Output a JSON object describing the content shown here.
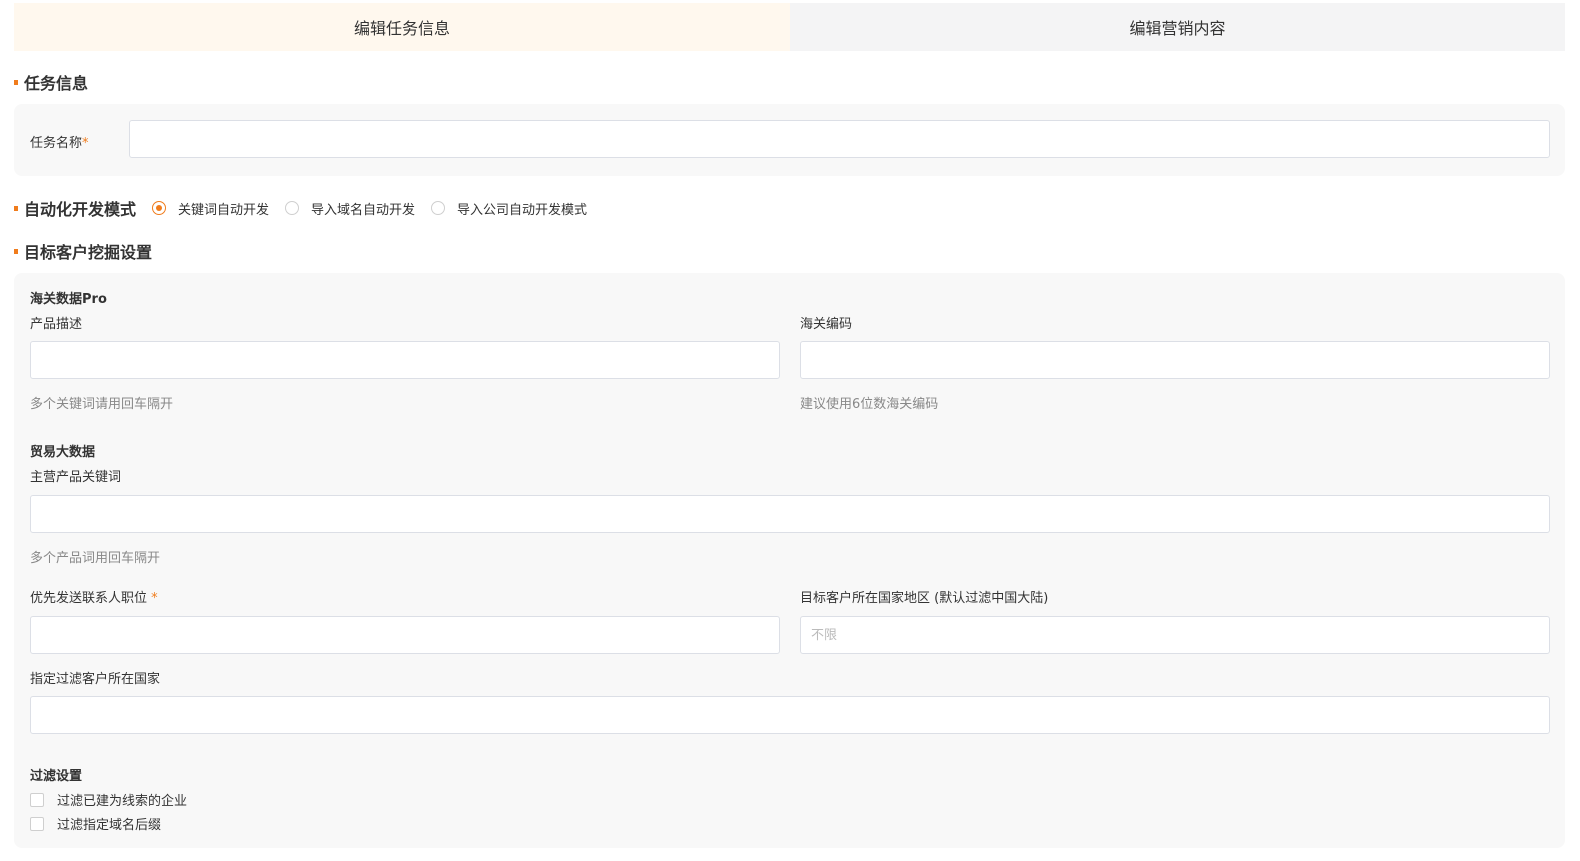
{
  "tabs": [
    {
      "label": "编辑任务信息",
      "active": true
    },
    {
      "label": "编辑营销内容",
      "active": false
    }
  ],
  "task_info": {
    "section_title": "任务信息",
    "name_label": "任务名称",
    "required_mark": "*",
    "name_value": ""
  },
  "mode": {
    "section_title": "自动化开发模式",
    "options": [
      {
        "label": "关键词自动开发",
        "checked": true
      },
      {
        "label": "导入域名自动开发",
        "checked": false
      },
      {
        "label": "导入公司自动开发模式",
        "checked": false
      }
    ]
  },
  "mining": {
    "section_title": "目标客户挖掘设置",
    "customs": {
      "group_title": "海关数据Pro",
      "product_label": "产品描述",
      "product_value": "",
      "product_hint": "多个关键词请用回车隔开",
      "hscode_label": "海关编码",
      "hscode_value": "",
      "hscode_hint": "建议使用6位数海关编码"
    },
    "trade": {
      "group_title": "贸易大数据",
      "keywords_label": "主营产品关键词",
      "keywords_value": "",
      "keywords_hint": "多个产品词用回车隔开"
    },
    "position_label": "优先发送联系人职位",
    "position_required": "*",
    "position_value": "",
    "country_label": "目标客户所在国家地区 (默认过滤中国大陆)",
    "country_placeholder": "不限",
    "filter_country_label": "指定过滤客户所在国家",
    "filter_country_value": "",
    "filter": {
      "group_title": "过滤设置",
      "options": [
        {
          "label": "过滤已建为线索的企业",
          "checked": false
        },
        {
          "label": "过滤指定域名后缀",
          "checked": false
        }
      ]
    }
  },
  "colors": {
    "accent": "#f07c1c",
    "active_tab_bg": "#fff8ee",
    "inactive_tab_bg": "#f4f4f5",
    "panel_bg": "#f8f8f8"
  }
}
